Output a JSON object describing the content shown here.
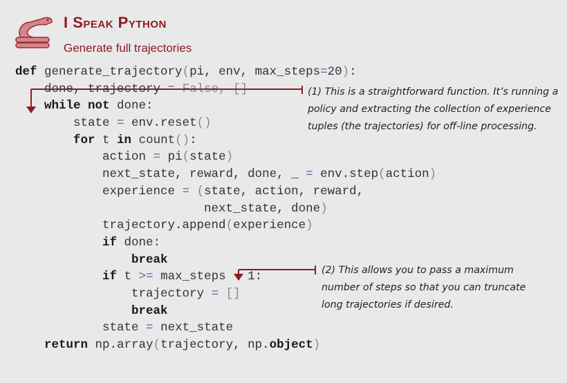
{
  "header": {
    "title": "I Speak Python",
    "subtitle": "Generate full trajectories",
    "accent_color": "#8c1c22",
    "logo_icon": "python-snake-icon"
  },
  "code": {
    "lines": [
      {
        "indent": 0,
        "parts": [
          [
            "kw",
            "def"
          ],
          [
            "t",
            " generate_trajectory"
          ],
          [
            "g",
            "("
          ],
          [
            "t",
            "pi, env, max_steps"
          ],
          [
            "op",
            "="
          ],
          [
            "t",
            "20"
          ],
          [
            "g",
            ")"
          ],
          [
            "t",
            ":"
          ]
        ]
      },
      {
        "indent": 1,
        "parts": [
          [
            "t",
            "done, trajectory "
          ],
          [
            "op",
            "="
          ],
          [
            "g",
            " False, []"
          ]
        ]
      },
      {
        "indent": 1,
        "parts": [
          [
            "kw",
            "while not"
          ],
          [
            "t",
            " done:"
          ]
        ]
      },
      {
        "indent": 2,
        "parts": [
          [
            "t",
            "state "
          ],
          [
            "op",
            "="
          ],
          [
            "t",
            " env.reset"
          ],
          [
            "g",
            "()"
          ]
        ]
      },
      {
        "indent": 2,
        "parts": [
          [
            "kw",
            "for"
          ],
          [
            "t",
            " t "
          ],
          [
            "kw",
            "in"
          ],
          [
            "t",
            " count"
          ],
          [
            "g",
            "()"
          ],
          [
            "t",
            ":"
          ]
        ]
      },
      {
        "indent": 3,
        "parts": [
          [
            "t",
            "action "
          ],
          [
            "op",
            "="
          ],
          [
            "t",
            " pi"
          ],
          [
            "g",
            "("
          ],
          [
            "t",
            "state"
          ],
          [
            "g",
            ")"
          ]
        ]
      },
      {
        "indent": 3,
        "parts": [
          [
            "t",
            "next_state, reward, done, _ "
          ],
          [
            "op",
            "="
          ],
          [
            "t",
            " env.step"
          ],
          [
            "g",
            "("
          ],
          [
            "t",
            "action"
          ],
          [
            "g",
            ")"
          ]
        ]
      },
      {
        "indent": 3,
        "parts": [
          [
            "t",
            "experience "
          ],
          [
            "op",
            "="
          ],
          [
            "t",
            " "
          ],
          [
            "g",
            "("
          ],
          [
            "t",
            "state, action, reward,"
          ]
        ]
      },
      {
        "indent": 3,
        "parts": [
          [
            "t",
            "              next_state, done"
          ],
          [
            "g",
            ")"
          ]
        ]
      },
      {
        "indent": 3,
        "parts": [
          [
            "t",
            "trajectory.append"
          ],
          [
            "g",
            "("
          ],
          [
            "t",
            "experience"
          ],
          [
            "g",
            ")"
          ]
        ]
      },
      {
        "indent": 3,
        "parts": [
          [
            "kw",
            "if"
          ],
          [
            "t",
            " done:"
          ]
        ]
      },
      {
        "indent": 4,
        "parts": [
          [
            "kw",
            "break"
          ]
        ]
      },
      {
        "indent": 3,
        "parts": [
          [
            "kw",
            "if"
          ],
          [
            "t",
            " t "
          ],
          [
            "op",
            ">="
          ],
          [
            "t",
            " max_steps "
          ],
          [
            "op",
            "-"
          ],
          [
            "t",
            " 1:"
          ]
        ]
      },
      {
        "indent": 4,
        "parts": [
          [
            "t",
            "trajectory "
          ],
          [
            "op",
            "="
          ],
          [
            "g",
            " []"
          ]
        ]
      },
      {
        "indent": 4,
        "parts": [
          [
            "kw",
            "break"
          ]
        ]
      },
      {
        "indent": 3,
        "parts": [
          [
            "t",
            "state "
          ],
          [
            "op",
            "="
          ],
          [
            "t",
            " next_state"
          ]
        ]
      },
      {
        "indent": 1,
        "parts": [
          [
            "kw",
            "return"
          ],
          [
            "t",
            " np.array"
          ],
          [
            "g",
            "("
          ],
          [
            "t",
            "trajectory, np."
          ],
          [
            "kw",
            "object"
          ],
          [
            "g",
            ")"
          ]
        ]
      }
    ]
  },
  "annotations": {
    "a1": "(1) This is a straightforward function. It’s running a policy and extracting the collection of experience tuples (the trajectories) for off-line processing.",
    "a2": "(2) This allows you to pass a maximum number of steps so that you can truncate long trajectories if desired."
  }
}
